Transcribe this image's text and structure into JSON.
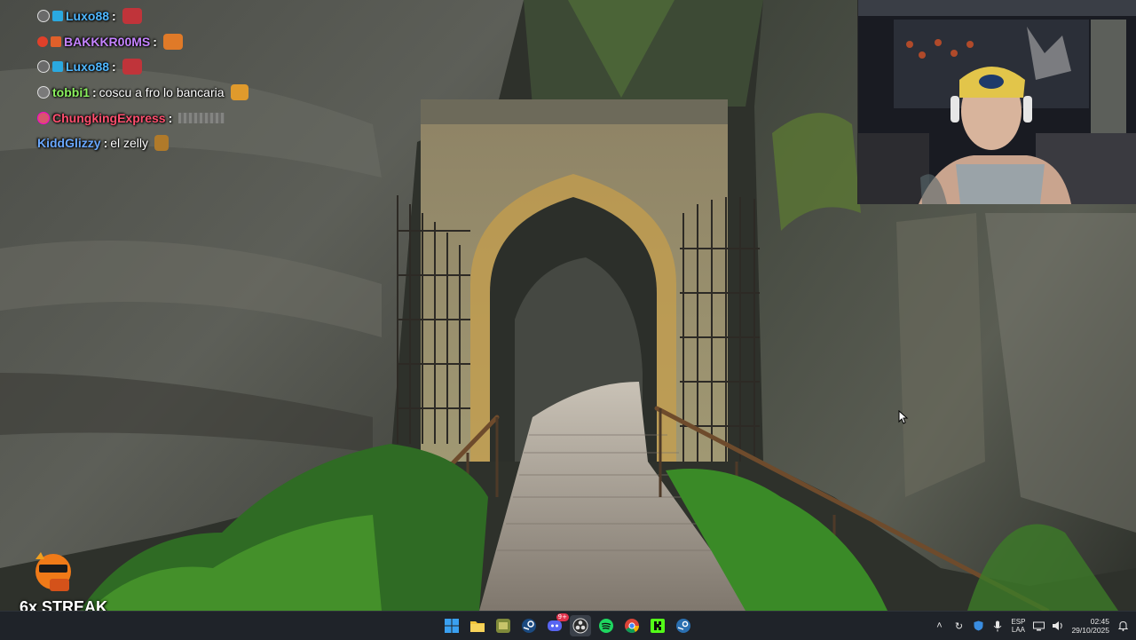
{
  "chat": {
    "messages": [
      {
        "user": "Luxo88",
        "user_color": "#4fb7ff",
        "text": "",
        "badges": [
          "gray-circle-badge",
          "cube-badge"
        ],
        "emote": "#c0343a"
      },
      {
        "user": "BAKKKR00MS",
        "user_color": "#c583ff",
        "text": "",
        "badges": [
          "red-circle-badge",
          "orange-square-badge"
        ],
        "emote": "#e07a28"
      },
      {
        "user": "Luxo88",
        "user_color": "#4fb7ff",
        "text": "",
        "badges": [
          "gray-circle-badge",
          "cube-badge"
        ],
        "emote": "#c0343a"
      },
      {
        "user": "tobbi1",
        "user_color": "#8cf25f",
        "text": "coscu a fro lo bancaria",
        "badges": [
          "gray-circle-badge"
        ],
        "emote": "#e09a2c"
      },
      {
        "user": "ChungkingExpress",
        "user_color": "#ff4f6e",
        "text": "",
        "badges": [
          "pink-circle-badge"
        ],
        "emote": ""
      },
      {
        "user": "KiddGlizzy",
        "user_color": "#6aa8ff",
        "text": "el zelly",
        "badges": [],
        "emote": "#b07a2a"
      }
    ]
  },
  "streak": {
    "label": "6x STREAK"
  },
  "taskbar": {
    "apps": [
      "windows-start",
      "file-explorer",
      "game-launcher",
      "steam",
      "discord",
      "obs-studio",
      "spotify",
      "chrome",
      "kick",
      "steam-alt"
    ],
    "discord_badge": "9+",
    "tray": {
      "language_top": "ESP",
      "language_bottom": "LAA",
      "time": "02:45",
      "date": "29/10/2025"
    }
  },
  "colors": {
    "taskbar_bg": "#1f2329",
    "accent_blue": "#0078d4",
    "spotify": "#1ed760",
    "kick": "#53fc18"
  }
}
